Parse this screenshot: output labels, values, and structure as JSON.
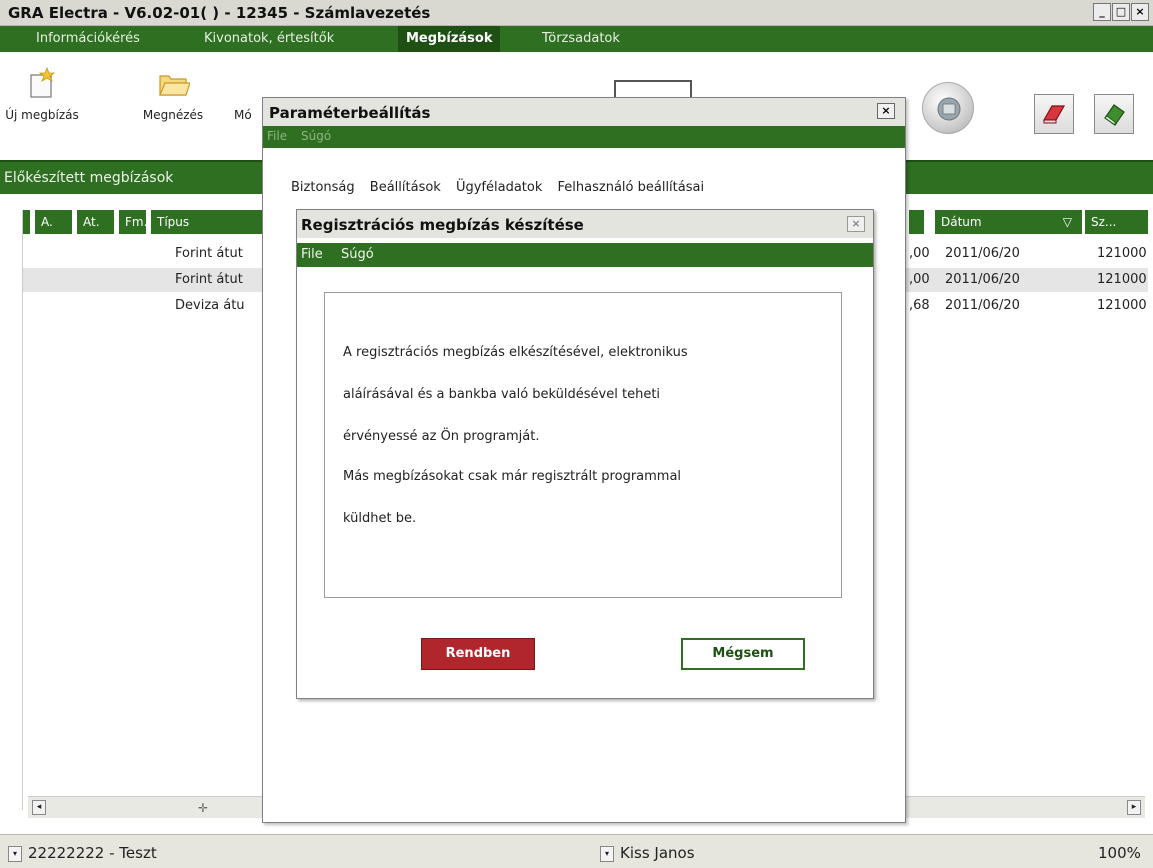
{
  "window": {
    "title": "GRA Electra - V6.02-01( ) - 12345 - Számlavezetés",
    "minimize": "_",
    "maximize": "□",
    "close": "×"
  },
  "menubar": {
    "items": [
      {
        "label": "Információkérés"
      },
      {
        "label": "Kivonatok, értesítők"
      },
      {
        "label": "Megbízások"
      },
      {
        "label": "Törzsadatok"
      }
    ],
    "active": "Megbízások"
  },
  "toolbar": {
    "new_order": "Új megbízás",
    "view": "Megnézés",
    "modify_partial": "Mó"
  },
  "section": {
    "title": "Előkészített megbízások"
  },
  "grid": {
    "headers": {
      "col_a": "A.",
      "col_at": "At.",
      "col_fm": "Fm.",
      "col_tipus": "Típus",
      "col_datum": "Dátum",
      "col_datum_sort": "▽",
      "col_sz": "Sz..."
    },
    "rows": [
      {
        "tipus": "Forint átut",
        "amount": ",00",
        "datum": "2011/06/20",
        "sz": "121000"
      },
      {
        "tipus": "Forint átut",
        "amount": ",00",
        "datum": "2011/06/20",
        "sz": "121000"
      },
      {
        "tipus": "Deviza átu",
        "amount": ",68",
        "datum": "2011/06/20",
        "sz": "121000"
      }
    ]
  },
  "statusbar": {
    "account": "22222222 - Teszt",
    "user": "Kiss Janos",
    "zoom": "100%"
  },
  "param_dialog": {
    "title": "Paraméterbeállítás",
    "close": "×",
    "menu_file": "File",
    "menu_help": "Súgó",
    "tabs": [
      "Biztonság",
      "Beállítások",
      "Ügyféladatok",
      "Felhasználó beállításai"
    ]
  },
  "reg_dialog": {
    "title": "Regisztrációs megbízás készítése",
    "close": "×",
    "menu_file": "File",
    "menu_help": "Súgó",
    "message_lines": [
      "A regisztrációs megbízás elkészítésével, elektronikus",
      "aláírásával és a bankba való beküldésével teheti",
      "érvényessé az Ön programját.",
      "Más megbízásokat csak már regisztrált programmal",
      "küldhet be."
    ],
    "ok_label": "Rendben",
    "cancel_label": "Mégsem"
  },
  "colors": {
    "brand_green": "#2e6f21",
    "dark_green": "#1d5012",
    "ok_red": "#b1262d"
  }
}
